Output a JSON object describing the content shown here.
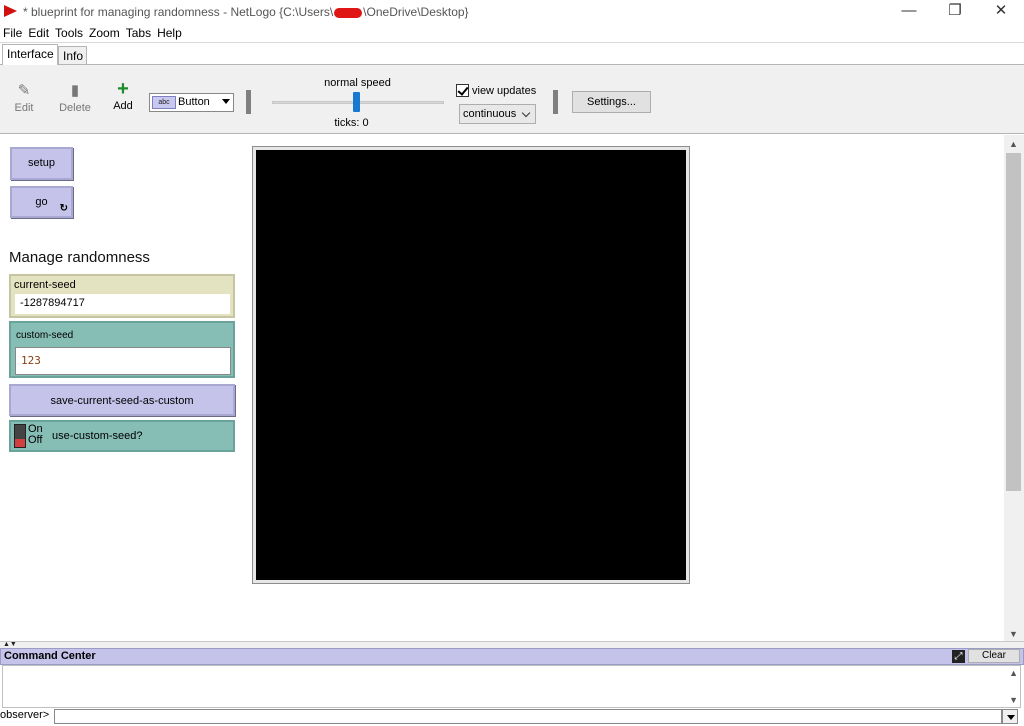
{
  "window": {
    "title_prefix": "* blueprint for managing randomness - NetLogo {C:\\Users\\",
    "title_suffix": "\\OneDrive\\Desktop}",
    "minimize": "—",
    "maximize": "❐",
    "close": "✕"
  },
  "menu": [
    "File",
    "Edit",
    "Tools",
    "Zoom",
    "Tabs",
    "Help"
  ],
  "tabs": [
    {
      "label": "Interface",
      "active": true
    },
    {
      "label": "Info",
      "active": false
    }
  ],
  "toolbar": {
    "edit_label": "Edit",
    "delete_label": "Delete",
    "add_label": "Add",
    "widget_type": "Button",
    "widget_badge": "abc",
    "speed_label": "normal speed",
    "ticks_label": "ticks: 0",
    "view_updates_label": "view updates",
    "view_updates_checked": true,
    "update_mode": "continuous",
    "settings_label": "Settings..."
  },
  "widgets": {
    "setup_label": "setup",
    "go_label": "go",
    "go_forever_icon": "↻",
    "note": "Manage randomness",
    "current_seed": {
      "name": "current-seed",
      "value": "-1287894717"
    },
    "custom_seed": {
      "name": "custom-seed",
      "value": "123"
    },
    "save_button_label": "save-current-seed-as-custom",
    "switch": {
      "on": "On",
      "off": "Off",
      "name": "use-custom-seed?"
    }
  },
  "command_center": {
    "title": "Command Center",
    "clear_label": "Clear",
    "prompt": "observer>",
    "input_value": ""
  },
  "colors": {
    "button_fill": "#c5c3ea",
    "monitor_fill": "#e4e3c1",
    "input_fill": "#86bdb5",
    "world_bg": "#000000",
    "speed_thumb": "#1979d2"
  }
}
